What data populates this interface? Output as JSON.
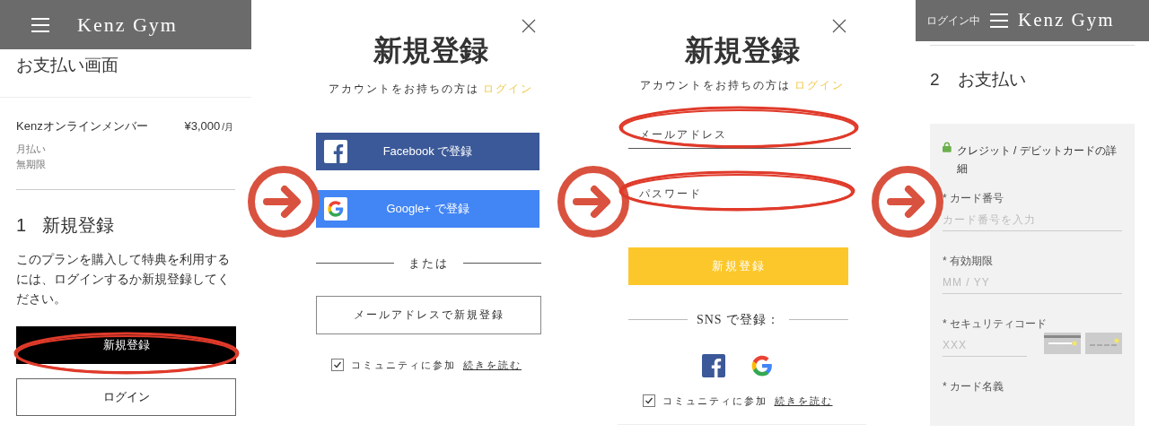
{
  "payment_screen": {
    "header": {
      "title": "Kenz Gym"
    },
    "page_title": "お支払い画面",
    "plan": {
      "name": "Kenzオンラインメンバー",
      "price": "¥3,000",
      "unit": "/月",
      "billing": "月払い",
      "term": "無期限"
    },
    "step": {
      "number": "1",
      "title": "新規登録"
    },
    "message": "このプランを購入して特典を利用するには、ログインするか新規登録してください。",
    "buttons": [
      {
        "label": "新規登録",
        "kind": "primary"
      },
      {
        "label": "ログイン",
        "kind": "outline"
      }
    ]
  },
  "signup_modal": {
    "title": "新規登録",
    "subtitle": "アカウントをお持ちの方は",
    "login_link": "ログイン",
    "social_buttons": [
      {
        "label": "Facebook で登録",
        "kind": "facebook"
      },
      {
        "label": "Google+ で登録",
        "kind": "google"
      }
    ],
    "separator": "または",
    "email_button": "メールアドレスで新規登録",
    "community": {
      "label": "コミュニティに参加",
      "link": "続きを読む",
      "checked": true
    }
  },
  "email_signup_modal": {
    "title": "新規登録",
    "subtitle": "アカウントをお持ちの方は",
    "login_link": "ログイン",
    "fields": [
      {
        "placeholder": "メールアドレス"
      },
      {
        "placeholder": "パスワード"
      }
    ],
    "submit": "新規登録",
    "separator": "SNS で登録：",
    "social_icons": [
      {
        "kind": "facebook"
      },
      {
        "kind": "google"
      }
    ],
    "community": {
      "label": "コミュニティに参加",
      "link": "続きを読む",
      "checked": true
    }
  },
  "card_payment_screen": {
    "header": {
      "status": "ログイン中",
      "title": "Kenz Gym"
    },
    "step": {
      "number": "2",
      "title": "お支払い"
    },
    "card_title": "クレジット / デビットカードの詳細",
    "fields": [
      {
        "label": "* カード番号",
        "placeholder": "カード番号を入力",
        "kind": "full"
      },
      {
        "label": "* 有効期限",
        "placeholder": "MM / YY",
        "kind": "full"
      },
      {
        "label": "* セキュリティコード",
        "placeholder": "XXX",
        "kind": "cvc"
      },
      {
        "label": "* カード名義",
        "kind": "label_only"
      }
    ]
  }
}
